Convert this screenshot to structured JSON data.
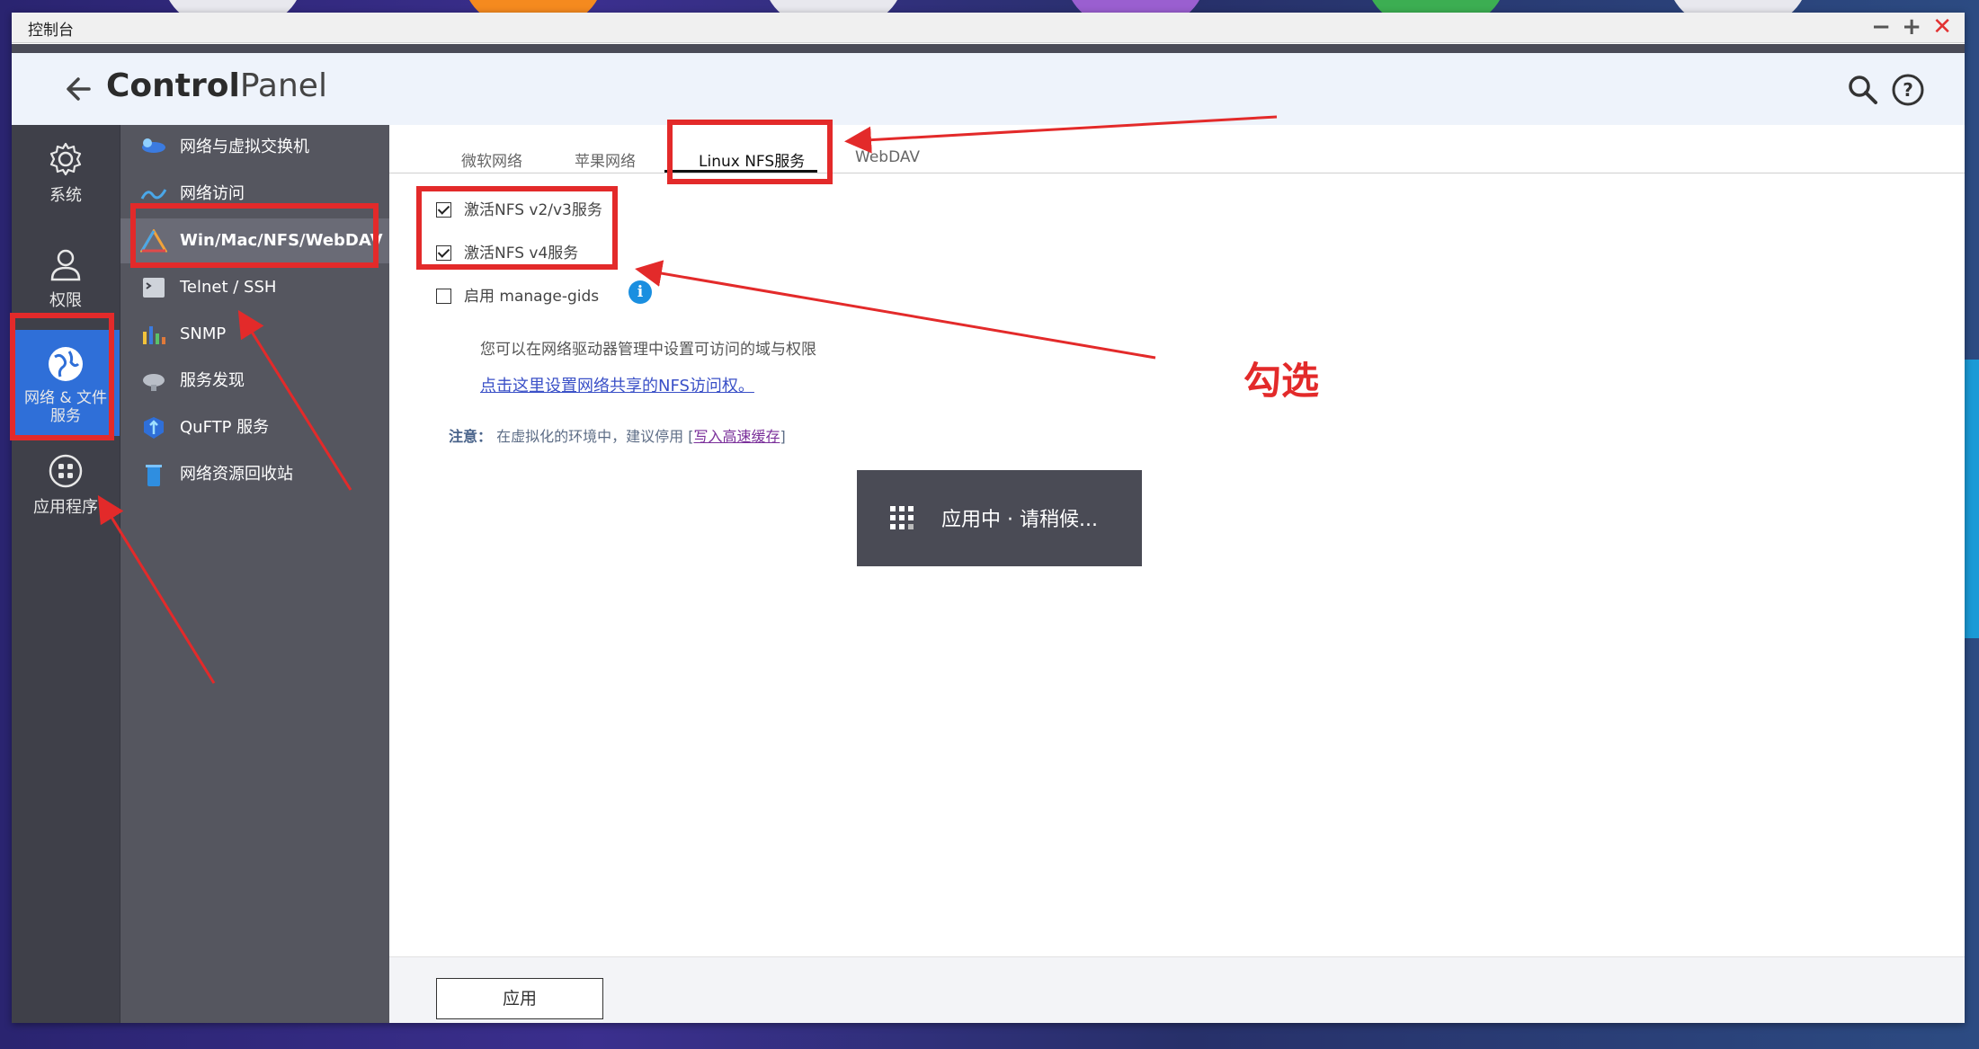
{
  "window": {
    "title": "控制台",
    "app_title_bold": "Control",
    "app_title_light": "Panel"
  },
  "rail": {
    "items": [
      {
        "label": "系统",
        "icon": "gear-icon"
      },
      {
        "label": "权限",
        "icon": "user-icon"
      },
      {
        "label": "网络 & 文件服务",
        "icon": "globe-icon",
        "active": true
      },
      {
        "label": "应用程序",
        "icon": "grid-icon"
      }
    ]
  },
  "subnav": {
    "items": [
      {
        "label": "网络与虚拟交换机",
        "icon": "network-switch-icon"
      },
      {
        "label": "网络访问",
        "icon": "network-access-icon"
      },
      {
        "label": "Win/Mac/NFS/WebDAV",
        "icon": "file-services-icon",
        "active": true
      },
      {
        "label": "Telnet / SSH",
        "icon": "terminal-icon"
      },
      {
        "label": "SNMP",
        "icon": "snmp-bar-icon"
      },
      {
        "label": "服务发现",
        "icon": "service-discovery-icon"
      },
      {
        "label": "QuFTP 服务",
        "icon": "ftp-icon"
      },
      {
        "label": "网络资源回收站",
        "icon": "recycle-bin-icon"
      }
    ]
  },
  "tabs": [
    {
      "label": "微软网络"
    },
    {
      "label": "苹果网络"
    },
    {
      "label": "Linux NFS服务",
      "active": true
    },
    {
      "label": "WebDAV"
    }
  ],
  "options": {
    "nfs_v2v3": {
      "label": "激活NFS v2/v3服务",
      "checked": true
    },
    "nfs_v4": {
      "label": "激活NFS v4服务",
      "checked": true
    },
    "manage_gids": {
      "label": "启用 manage-gids",
      "checked": false
    }
  },
  "hint_text": "您可以在网络驱动器管理中设置可访问的域与权限",
  "nfs_link_text": "点击这里设置网络共享的NFS访问权。",
  "note": {
    "label": "注意：",
    "text": "在虚拟化的环境中，建议停用 [",
    "link": "写入高速缓存",
    "end": "]"
  },
  "toast": {
    "text": "应用中 · 请稍候..."
  },
  "footer": {
    "apply_label": "应用"
  },
  "annotation": {
    "text": "勾选"
  },
  "colors": {
    "accent": "#2f6fd8",
    "annotation_red": "#e32a2a",
    "rail_bg": "#3f4049",
    "subnav_bg": "#55565f"
  }
}
